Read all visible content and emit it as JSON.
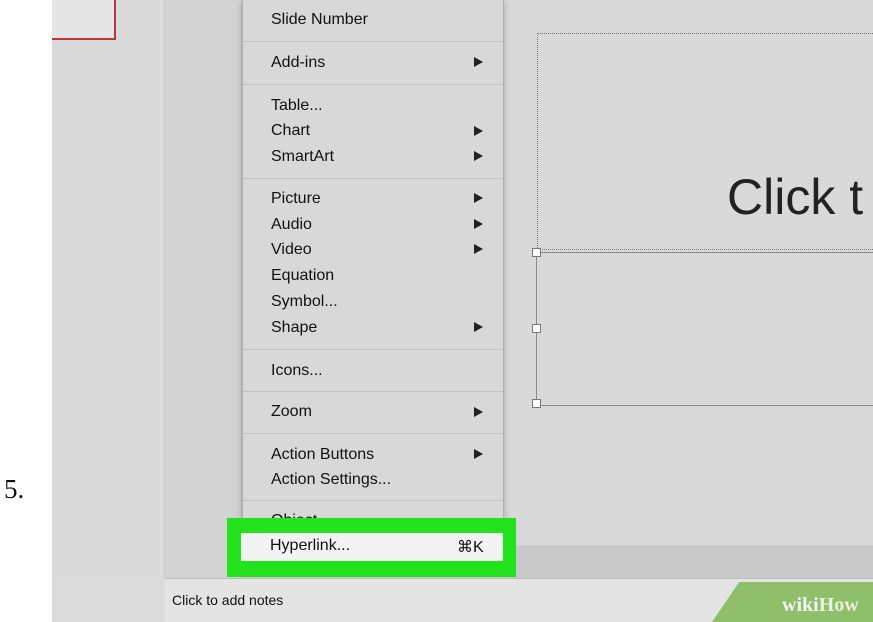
{
  "step": {
    "number": "5."
  },
  "slide": {
    "title_placeholder": "Click t"
  },
  "notes": {
    "placeholder": "Click to add notes"
  },
  "branding": {
    "wiki": "wiki",
    "how": "How"
  },
  "menu": {
    "slide_number": "Slide Number",
    "add_ins": "Add-ins",
    "table": "Table...",
    "chart": "Chart",
    "smartart": "SmartArt",
    "picture": "Picture",
    "audio": "Audio",
    "video": "Video",
    "equation": "Equation",
    "symbol": "Symbol...",
    "shape": "Shape",
    "icons": "Icons...",
    "zoom": "Zoom",
    "action_buttons": "Action Buttons",
    "action_settings": "Action Settings...",
    "object": "Object...",
    "hyperlink": "Hyperlink...",
    "hyperlink_shortcut": "⌘K"
  },
  "colors": {
    "highlight": "#22e21e",
    "wikihow_green": "#8fbf6b",
    "thumb_border": "#b23a3a"
  }
}
